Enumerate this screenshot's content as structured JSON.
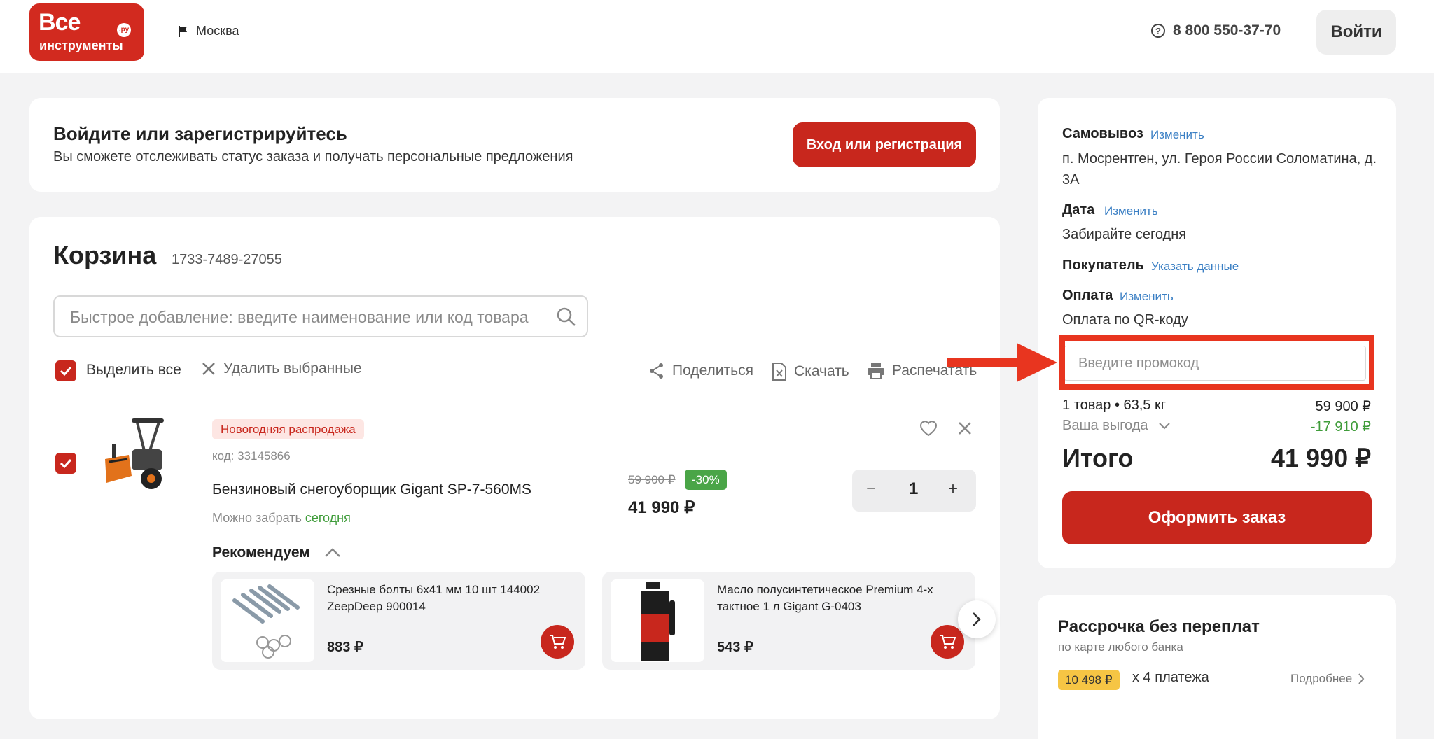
{
  "header": {
    "logo_line1": "Все",
    "logo_line2": "инструменты",
    "logo_ru": ".ру",
    "city": "Москва",
    "phone": "8 800 550-37-70",
    "login": "Войти"
  },
  "auth_banner": {
    "title": "Войдите или зарегистрируйтесь",
    "subtitle": "Вы сможете отслеживать статус заказа и получать персональные предложения",
    "button": "Вход или регистрация"
  },
  "cart": {
    "title": "Корзина",
    "code": "1733-7489-27055",
    "search_placeholder": "Быстрое добавление: введите наименование или код товара",
    "select_all": "Выделить все",
    "delete_selected": "Удалить выбранные",
    "share": "Поделиться",
    "download": "Скачать",
    "print": "Распечатать",
    "item": {
      "tag": "Новогодняя распродажа",
      "code": "код: 33145866",
      "name": "Бензиновый снегоуборщик Gigant SP-7-560MS",
      "pickup_prefix": "Можно забрать ",
      "pickup_when": "сегодня",
      "old_price": "59 900 ₽",
      "discount": "-30%",
      "price": "41 990 ₽",
      "quantity": "1"
    },
    "recommend_title": "Рекомендуем",
    "recommendations": [
      {
        "name": "Срезные болты 6х41 мм 10 шт 144002 ZeepDeep 900014",
        "price": "883 ₽"
      },
      {
        "name": "Масло полусинтетическое Premium 4-х тактное 1 л Gigant G-0403",
        "price": "543 ₽"
      }
    ]
  },
  "order": {
    "pickup_label": "Самовывоз",
    "pickup_change": "Изменить",
    "pickup_address": "п. Мосрентген, ул. Героя России Соломатина, д. 3А",
    "date_label": "Дата",
    "date_change": "Изменить",
    "date_value": "Забирайте сегодня",
    "buyer_label": "Покупатель",
    "buyer_link": "Указать данные",
    "payment_label": "Оплата",
    "payment_change": "Изменить",
    "payment_value": "Оплата по QR-коду",
    "promo_placeholder": "Введите промокод",
    "items_summary": "1 товар • 63,5 кг",
    "items_price": "59 900 ₽",
    "benefit_label": "Ваша выгода",
    "benefit_value": "-17 910 ₽",
    "total_label": "Итого",
    "total_value": "41 990 ₽",
    "checkout": "Оформить заказ"
  },
  "installment": {
    "title": "Рассрочка без переплат",
    "subtitle": "по карте любого банка",
    "amount": "10 498 ₽",
    "times": "х 4 платежа",
    "more": "Подробнее"
  },
  "colors": {
    "brand_red": "#c8271d",
    "highlight_red": "#e8351f",
    "green": "#4aa547",
    "link_blue": "#3a7fc4"
  }
}
